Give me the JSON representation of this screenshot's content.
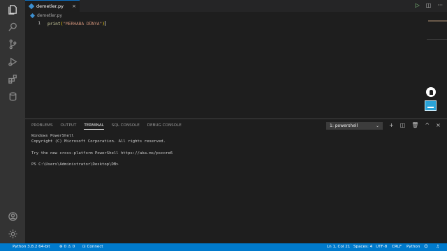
{
  "editor": {
    "tab_label": "demetler.py",
    "tab_close": "×",
    "breadcrumb": "demetler.py",
    "line_number": "1",
    "code": {
      "fn": "print",
      "open": "(",
      "string": "\"MERHABA DÜNYA\"",
      "close": ")"
    }
  },
  "editor_actions": {
    "run": "▷",
    "split": "◫",
    "more": "···"
  },
  "panel": {
    "tabs": [
      "PROBLEMS",
      "OUTPUT",
      "TERMINAL",
      "SQL CONSOLE",
      "DEBUG CONSOLE"
    ],
    "active_tab": "TERMINAL",
    "terminal_select": "1: powershell",
    "actions": {
      "add": "+",
      "split": "◫",
      "trash": "🗑",
      "maximize": "^",
      "close": "×"
    },
    "terminal_lines": [
      "Windows PowerShell",
      "Copyright (C) Microsoft Corporation. All rights reserved.",
      "",
      "Try the new cross-platform PowerShell https://aka.ms/pscore6",
      "",
      "PS C:\\Users\\Administrator\\Desktop\\DB>"
    ]
  },
  "status": {
    "python": "Python 3.8.2 64-bit",
    "problems": "⊗ 0  ⚠ 0",
    "connect": "⊡ Connect",
    "position": "Ln 1, Col 21",
    "spaces": "Spaces: 4",
    "encoding": "UTF-8",
    "eol": "CRLF",
    "language": "Python"
  },
  "colors": {
    "accent": "#007acc",
    "activity_bar": "#333333",
    "editor_bg": "#1e1e1e",
    "string": "#ce9178",
    "function": "#dcdcaa"
  },
  "icons": [
    "files-icon",
    "search-icon",
    "source-control-icon",
    "debug-icon",
    "extensions-icon",
    "database-icon",
    "account-icon",
    "settings-gear-icon"
  ]
}
